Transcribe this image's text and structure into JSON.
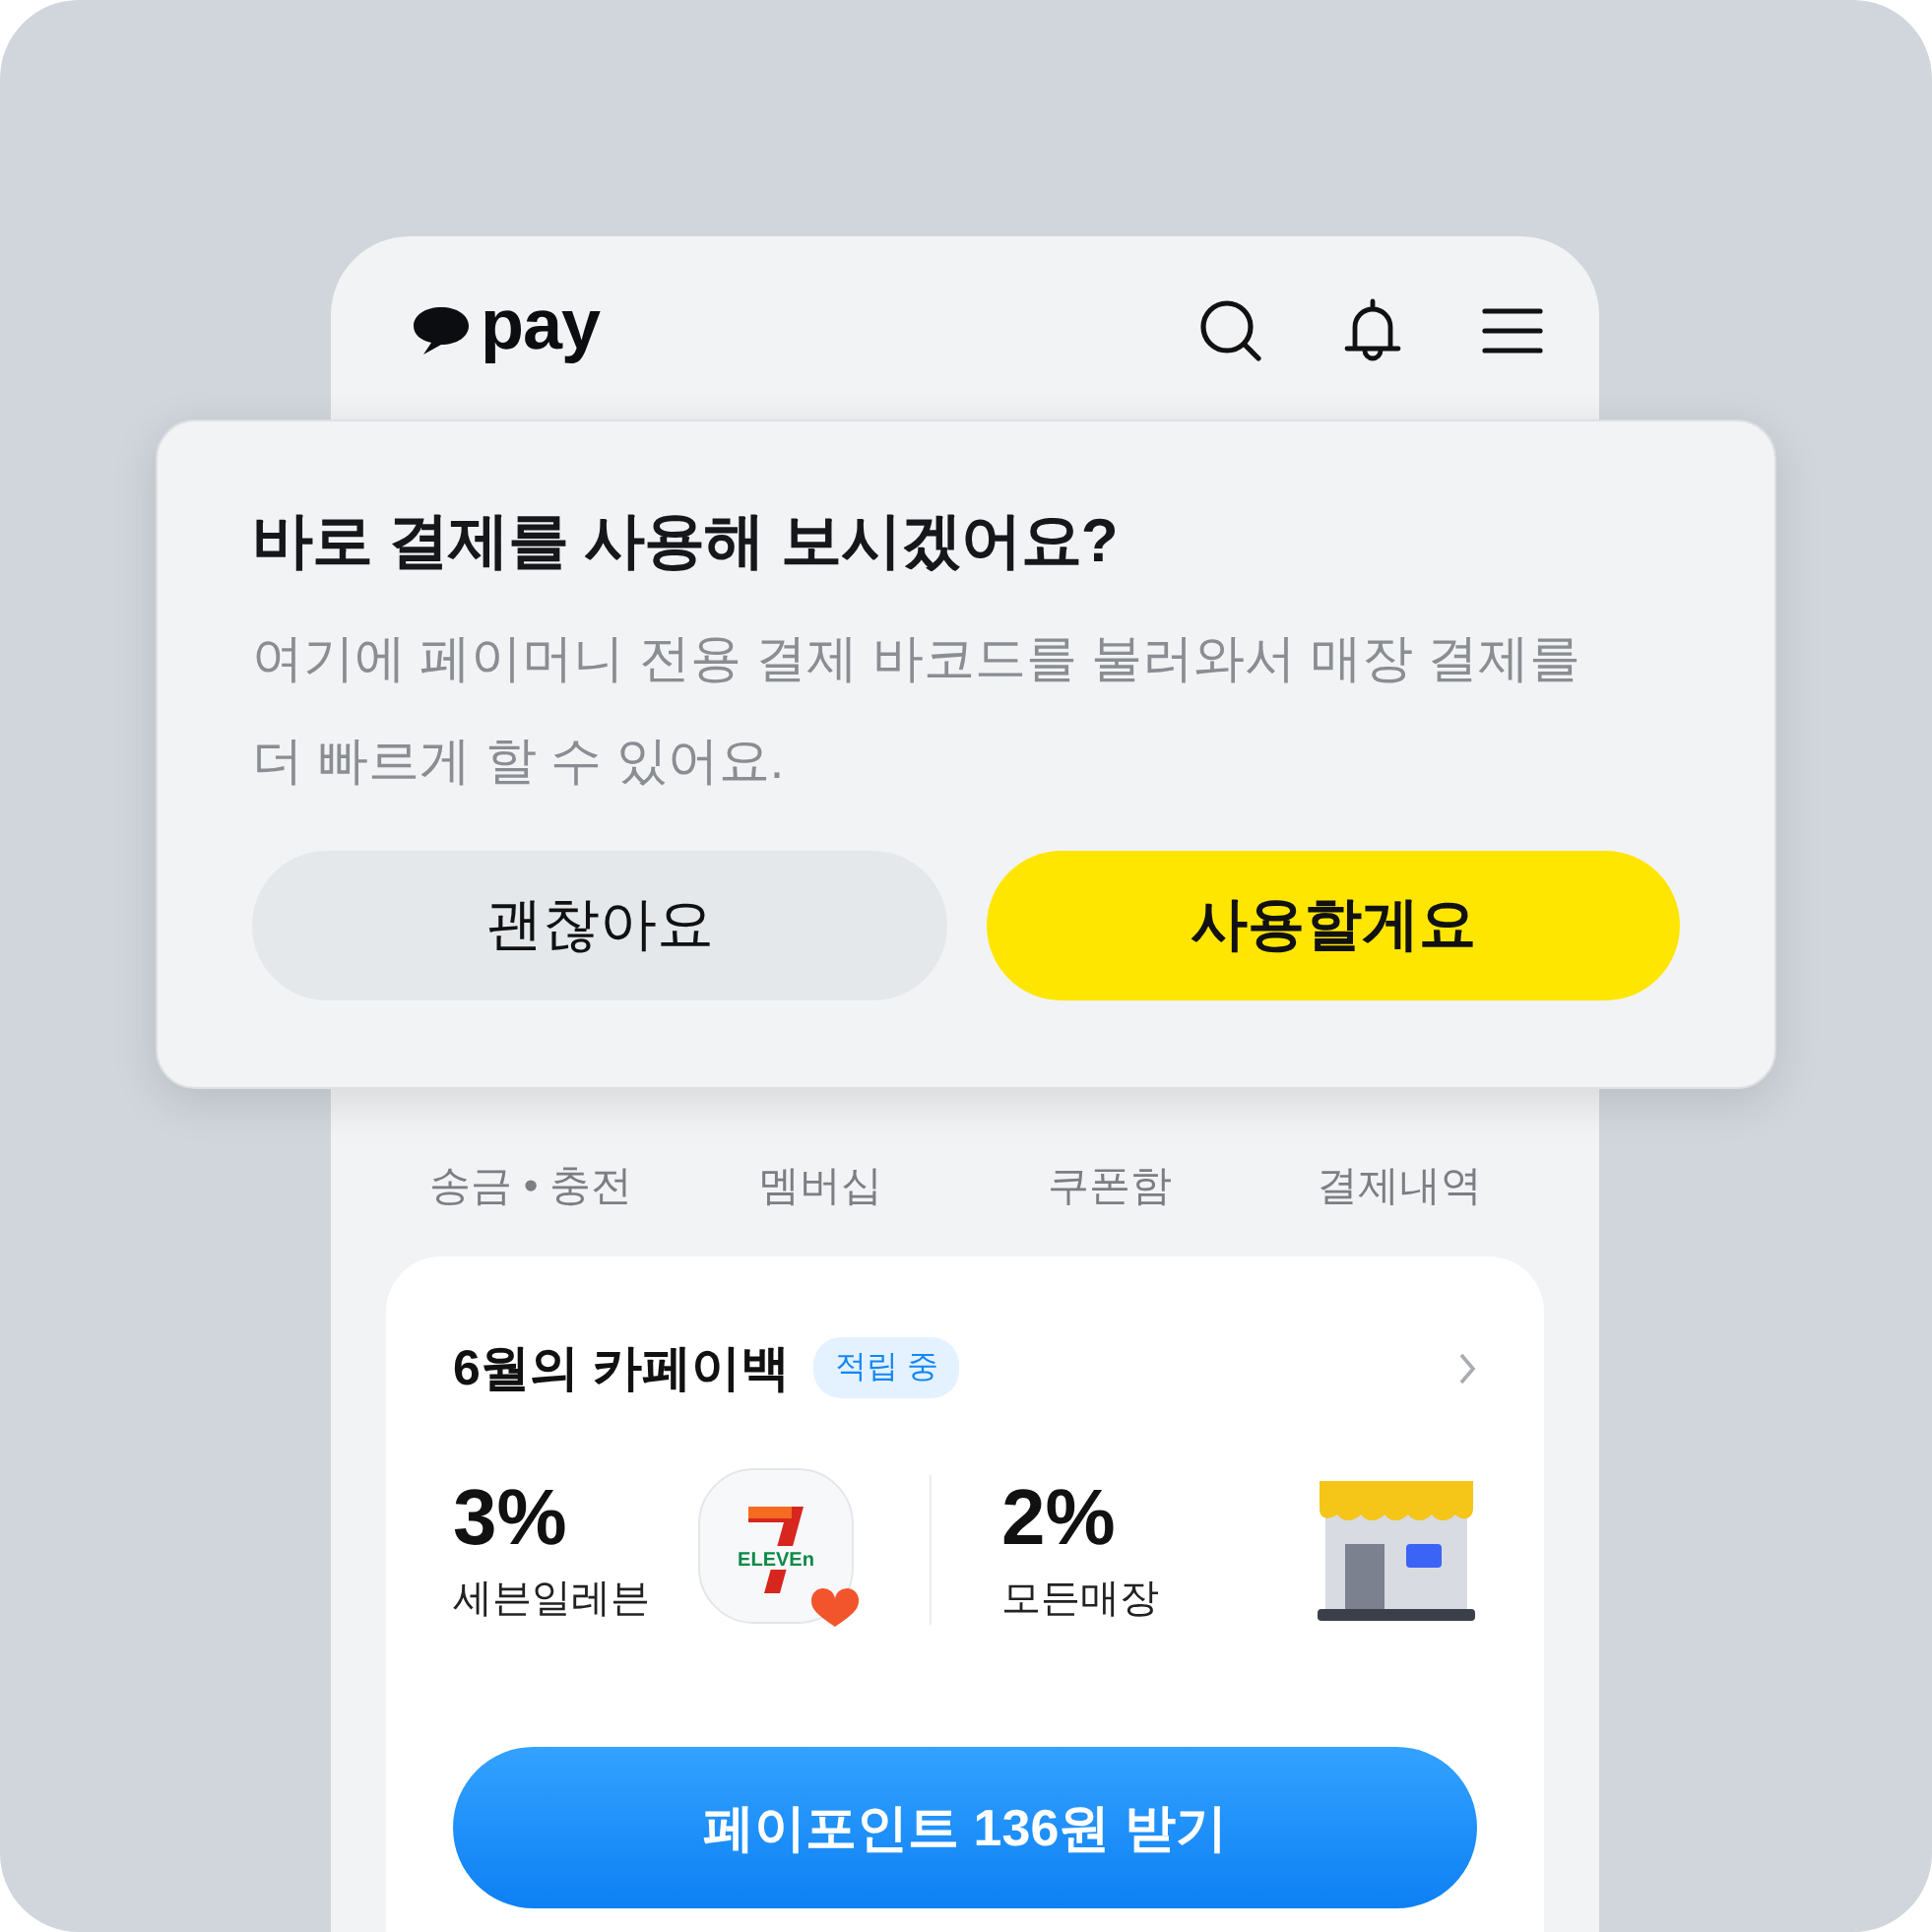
{
  "header": {
    "logo": "pay"
  },
  "dialog": {
    "title": "바로 결제를 사용해 보시겠어요?",
    "message": "여기에 페이머니 전용 결제 바코드를 불러와서 매장 결제를 더 빠르게 할 수 있어요.",
    "buttons": [
      {
        "label": "괜찮아요",
        "kind": "secondary"
      },
      {
        "label": "사용할게요",
        "kind": "primary"
      }
    ]
  },
  "quick_menu": [
    "송금 • 충전",
    "멤버십",
    "쿠폰함",
    "결제내역"
  ],
  "cashback": {
    "title": "6월의 카페이백",
    "badge": "적립 중",
    "offers": [
      {
        "rate": "3%",
        "store": "세븐일레븐",
        "kind": "brand",
        "logo_text": "ELEVEn"
      },
      {
        "rate": "2%",
        "store": "모든매장",
        "kind": "store"
      }
    ],
    "action": "페이포인트 136원 받기"
  }
}
